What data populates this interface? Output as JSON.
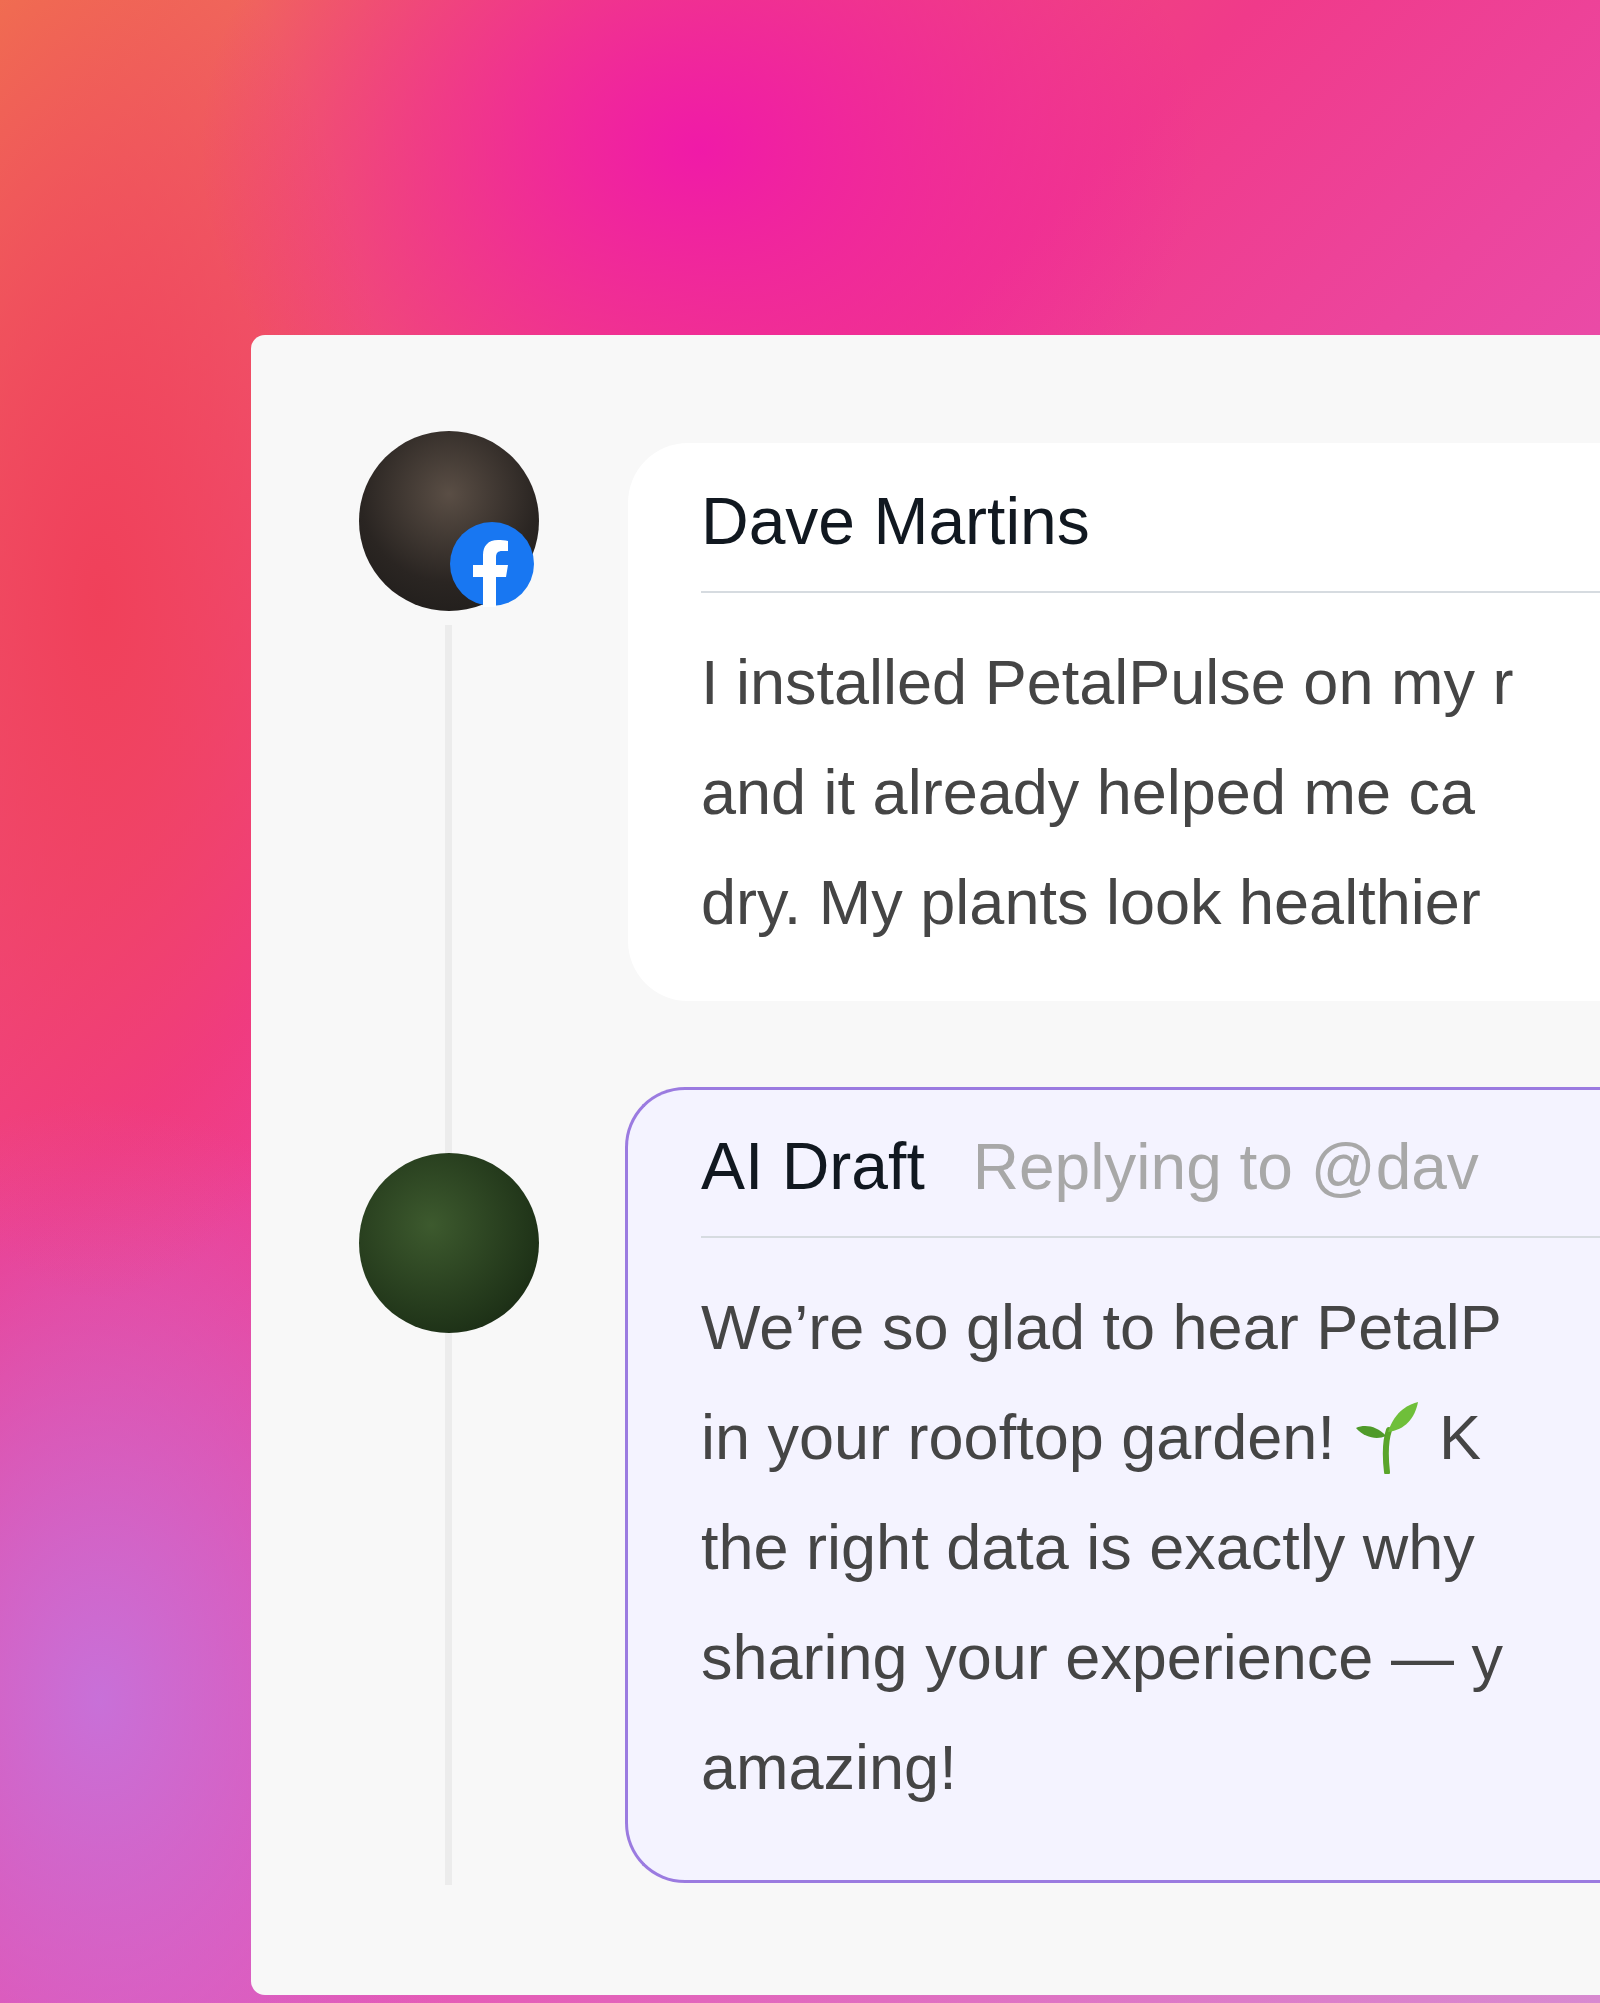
{
  "thread": [
    {
      "kind": "comment",
      "author": "Dave Martins",
      "lines": [
        {
          "kind": "plain",
          "text": "I installed PetalPulse on my r"
        },
        {
          "kind": "plain",
          "text": "and it already helped me ca"
        },
        {
          "kind": "plain",
          "text": "dry. My plants look healthier"
        }
      ]
    },
    {
      "kind": "draft",
      "author": "AI Draft",
      "replying_to": "Replying to @dav",
      "lines": [
        {
          "kind": "plain",
          "text": "We’re so glad to hear PetalP"
        },
        {
          "kind": "sprout",
          "text": "in your rooftop garden!",
          "after": "K"
        },
        {
          "kind": "plain",
          "text": "the right data is exactly why"
        },
        {
          "kind": "plain",
          "text": "sharing your experience — y"
        },
        {
          "kind": "plain",
          "text": "amazing!"
        }
      ]
    }
  ]
}
